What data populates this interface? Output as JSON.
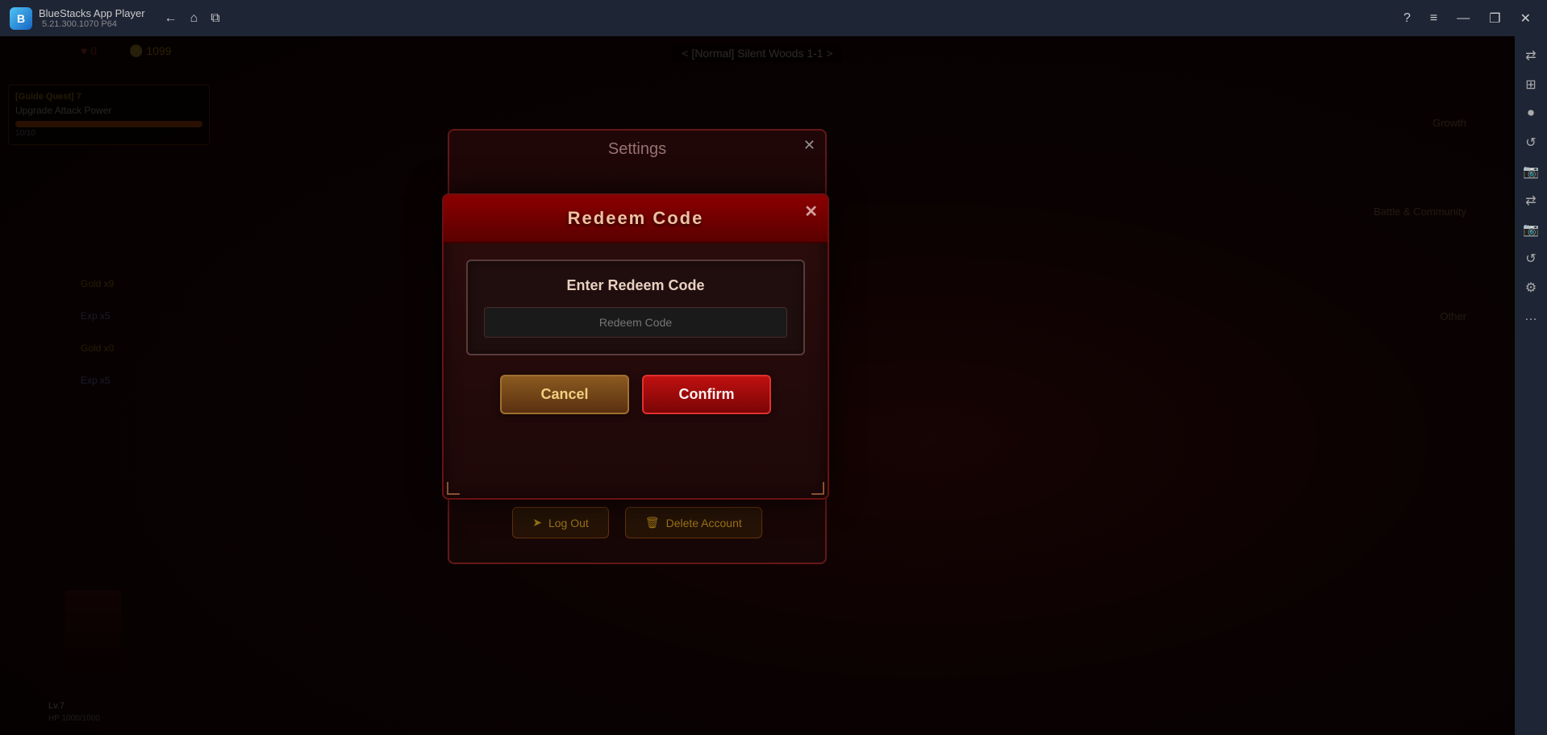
{
  "titleBar": {
    "appName": "BlueStacks App Player",
    "version": "5.21.300.1070  P64",
    "logoText": "B",
    "controls": {
      "help": "?",
      "menu": "≡",
      "minimize": "—",
      "restore": "❐",
      "close": "✕"
    },
    "nav": {
      "back": "←",
      "home": "⌂",
      "copy": "⧉"
    }
  },
  "sidebar": {
    "icons": [
      "?",
      "≡",
      "⏺",
      "↺",
      "📷",
      "⇄",
      "📷",
      "↺",
      "⚙",
      "…"
    ]
  },
  "hud": {
    "hearts": "♥ 0",
    "gold": "🪙 1099",
    "stage": "< [Normal] Silent Woods 1-1 >"
  },
  "quest": {
    "title": "[Guide Quest] 7",
    "description": "Upgrade Attack Power",
    "progress": "10/10"
  },
  "settingsDialog": {
    "title": "Settings",
    "closeBtn": "✕",
    "logoutBtn": "Log Out",
    "deleteAccountBtn": "Delete Account"
  },
  "redeemModal": {
    "title": "Redeem Code",
    "closeBtn": "✕",
    "inputLabel": "Enter Redeem Code",
    "inputPlaceholder": "Redeem Code",
    "cancelBtn": "Cancel",
    "confirmBtn": "Confirm"
  },
  "rightPanel": {
    "growthLabel": "Growth",
    "battleLabel": "Battle & Community",
    "otherLabel": "Other"
  }
}
